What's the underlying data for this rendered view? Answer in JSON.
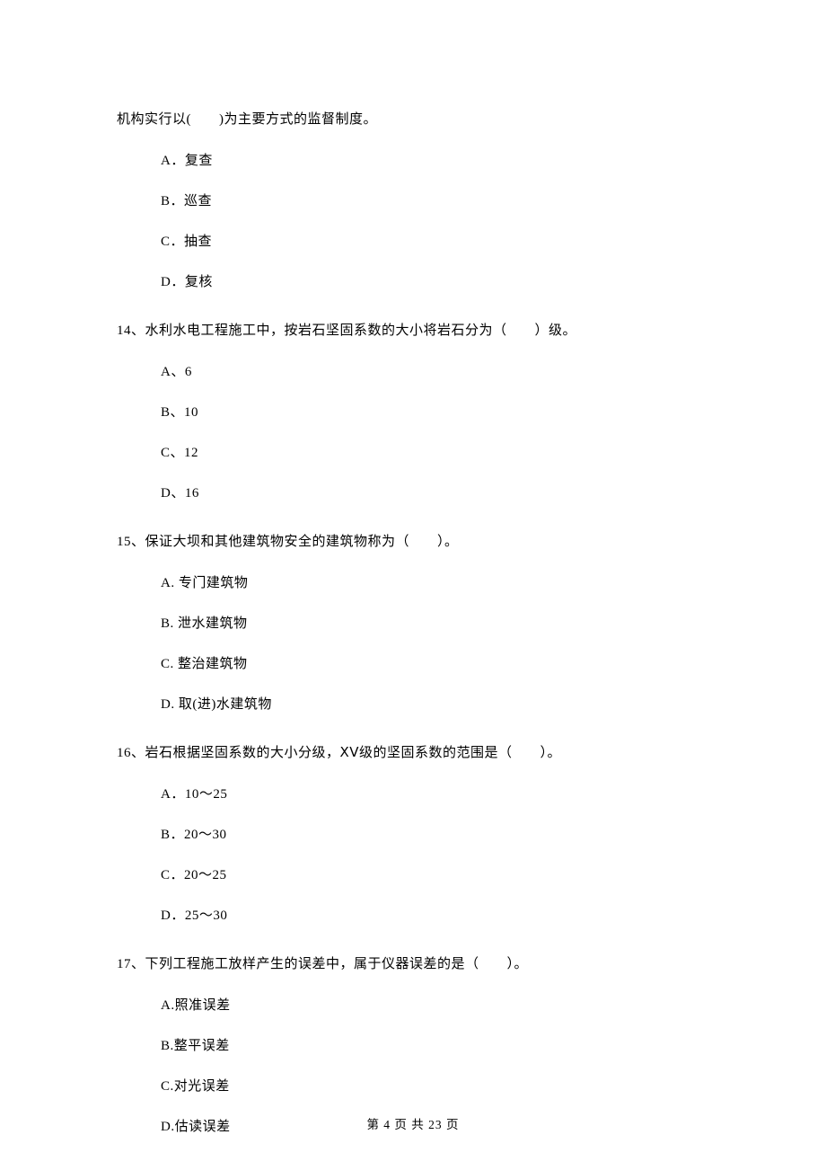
{
  "q13": {
    "stem_continuation": "机构实行以(　　)为主要方式的监督制度。",
    "options": {
      "a": "A．复查",
      "b": "B．巡查",
      "c": "C．抽查",
      "d": "D．复核"
    }
  },
  "q14": {
    "stem": "14、水利水电工程施工中，按岩石坚固系数的大小将岩石分为（　　）级。",
    "options": {
      "a": "A、6",
      "b": "B、10",
      "c": "C、12",
      "d": "D、16"
    }
  },
  "q15": {
    "stem": "15、保证大坝和其他建筑物安全的建筑物称为（　　）。",
    "options": {
      "a": "A.  专门建筑物",
      "b": "B.  泄水建筑物",
      "c": "C.  整治建筑物",
      "d": "D.  取(进)水建筑物"
    }
  },
  "q16": {
    "stem": "16、岩石根据坚固系数的大小分级，ⅩⅤ级的坚固系数的范围是（　　）。",
    "options": {
      "a": "A．10～25",
      "b": "B．20～30",
      "c": "C．20～25",
      "d": "D．25～30"
    }
  },
  "q17": {
    "stem": "17、下列工程施工放样产生的误差中，属于仪器误差的是（　　）。",
    "options": {
      "a": "A.照准误差",
      "b": "B.整平误差",
      "c": "C.对光误差",
      "d": "D.估读误差"
    }
  },
  "footer": "第 4 页 共 23 页"
}
